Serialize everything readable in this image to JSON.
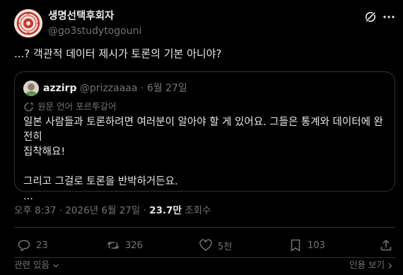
{
  "author": {
    "display_name": "생명선택후회자",
    "handle": "@go3studytogouni"
  },
  "post": {
    "text": "...? 객관적 데이터 제시가 토론의 기본 아니야?"
  },
  "quote": {
    "display_name": "azzirp",
    "handle": "@prizzaaaa",
    "separator": "·",
    "date": "6월 27일",
    "translate_label": "원문 언어 포르투갈어",
    "body_line1": "일본 사람들과 토론하려면 여러분이 알아야 할 게 있어요. 그들은 통계와 데이터에 완전히",
    "body_line2": "집착해요!",
    "body_line3": "그리고 그걸로 토론을 반박하거든요.",
    "body_line4": "..."
  },
  "meta": {
    "time_date": "오후 8:37 · 2026년 6월 27일 ·",
    "views_count": "23.7만",
    "views_label": "조회수"
  },
  "actions": {
    "replies": "23",
    "reposts": "326",
    "likes": "5천",
    "bookmarks": "103"
  },
  "footer": {
    "related": "관련 있음",
    "view_replies": "인용 보기"
  },
  "colors": {
    "background": "#000000",
    "text": "#e7e9ea",
    "muted": "#71767b",
    "border": "#2f3336",
    "avatar_red": "#c0392b"
  },
  "icons": [
    "grok-icon",
    "more-icon",
    "translate-icon",
    "reply-icon",
    "repost-icon",
    "like-icon",
    "bookmark-icon",
    "share-icon",
    "chevron-down-icon",
    "chevron-right-icon"
  ]
}
